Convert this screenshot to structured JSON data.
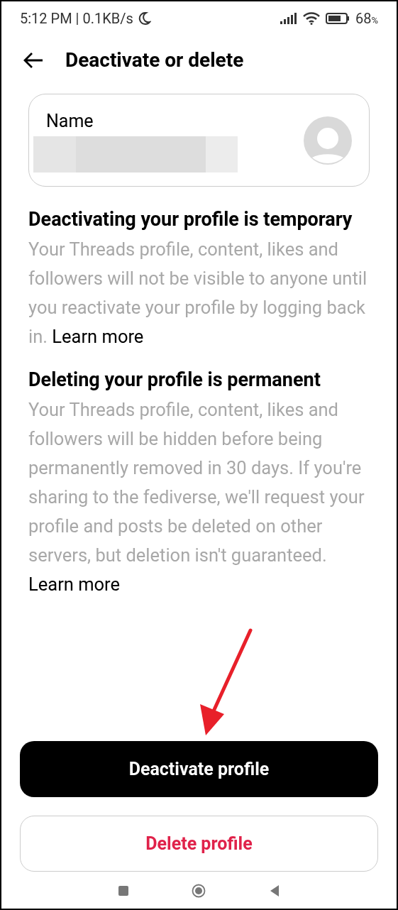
{
  "status_bar": {
    "time": "5:12 PM",
    "separator": "|",
    "speed": "0.1KB/s",
    "battery": "68",
    "battery_unit": "%"
  },
  "header": {
    "title": "Deactivate or delete"
  },
  "profile_card": {
    "label": "Name"
  },
  "sections": [
    {
      "title": "Deactivating your profile is temporary",
      "body": "Your Threads profile, content, likes and followers will not be visible to anyone until you reactivate your profile by logging back in.",
      "link": "Learn more"
    },
    {
      "title": "Deleting your profile is permanent",
      "body": "Your Threads profile, content, likes and followers will be hidden before being permanently removed in 30 days. If you're sharing to the fediverse, we'll request your profile and posts be deleted on other servers, but deletion isn't guaranteed.",
      "link": "Learn more"
    }
  ],
  "buttons": [
    {
      "label": "Deactivate profile",
      "kind": "primary"
    },
    {
      "label": "Delete profile",
      "kind": "danger"
    }
  ]
}
